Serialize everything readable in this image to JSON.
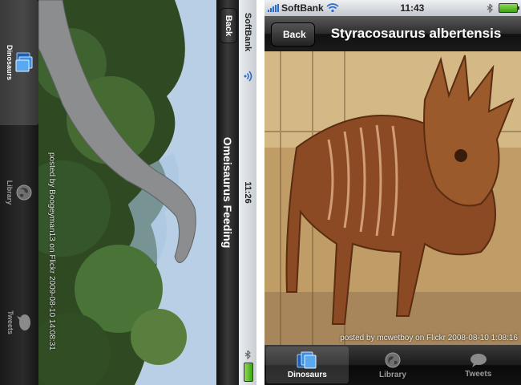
{
  "left_screen": {
    "status_bar": {
      "carrier": "SoftBank",
      "time": "11:26"
    },
    "nav_bar": {
      "back_label": "Back",
      "title": "Omeisaurus Feeding"
    },
    "photo": {
      "credit": "posted by Boogeyman13 on Flickr 2009-08-10 14:08:31"
    },
    "tab_bar": {
      "items": [
        {
          "label": "Dinosaurs",
          "icon": "dinosaurs-cards-icon",
          "selected": true
        },
        {
          "label": "Library",
          "icon": "library-globe-icon",
          "selected": false
        },
        {
          "label": "Tweets",
          "icon": "tweets-bubble-icon",
          "selected": false
        }
      ]
    }
  },
  "right_screen": {
    "status_bar": {
      "carrier": "SoftBank",
      "time": "11:43"
    },
    "nav_bar": {
      "back_label": "Back",
      "title": "Styracosaurus albertensis"
    },
    "photo": {
      "credit": "posted by mcwetboy on Flickr 2008-08-10 1:08:16"
    },
    "tab_bar": {
      "items": [
        {
          "label": "Dinosaurs",
          "icon": "dinosaurs-cards-icon",
          "selected": true
        },
        {
          "label": "Library",
          "icon": "library-globe-icon",
          "selected": false
        },
        {
          "label": "Tweets",
          "icon": "tweets-bubble-icon",
          "selected": false
        }
      ]
    }
  },
  "colors": {
    "selected_icon": "#3a8ee6",
    "unselected_icon": "#8a8a8a",
    "battery": "#4cb81e",
    "signal": "#2b6acb"
  }
}
